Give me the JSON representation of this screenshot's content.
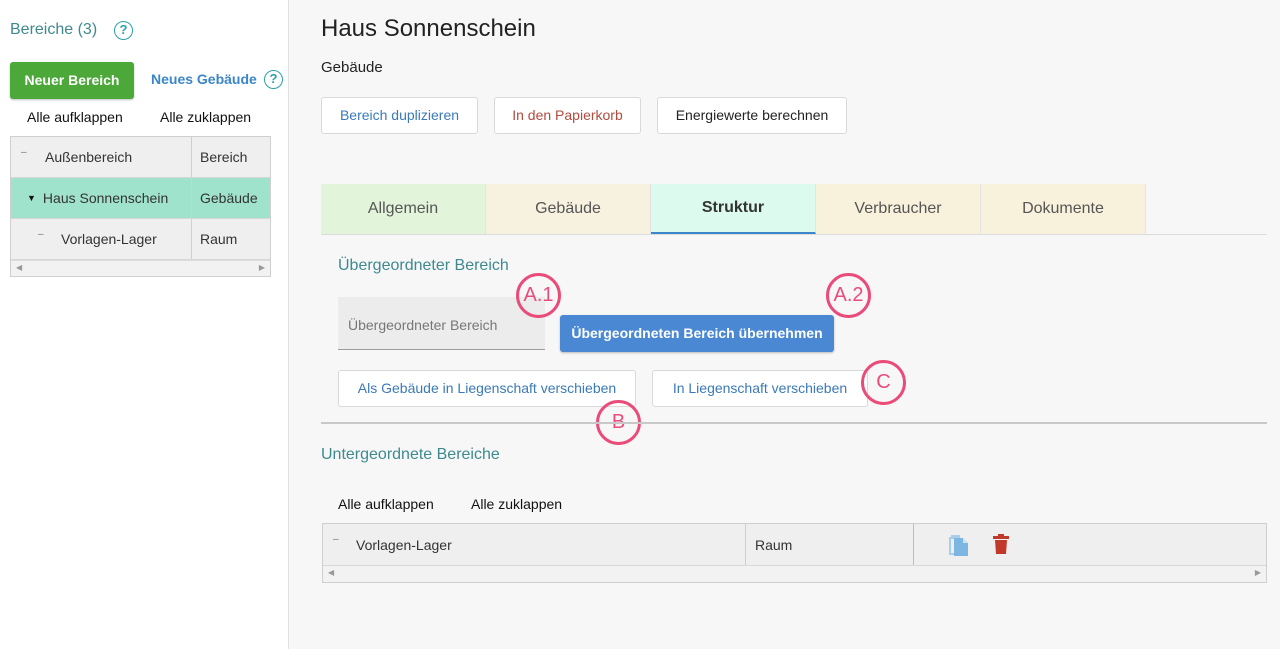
{
  "sidebar": {
    "title": "Bereiche (3)",
    "help": "?",
    "new_area_button": "Neuer Bereich",
    "new_building_link": "Neues Gebäude",
    "expand_all": "Alle aufklappen",
    "collapse_all": "Alle zuklappen",
    "tree": [
      {
        "name": "Außenbereich",
        "type": "Bereich"
      },
      {
        "name": "Haus Sonnenschein",
        "type": "Gebäude",
        "selected": true
      },
      {
        "name": "Vorlagen-Lager",
        "type": "Raum"
      }
    ]
  },
  "main": {
    "title": "Haus Sonnenschein",
    "subtitle": "Gebäude",
    "actions": {
      "duplicate": "Bereich duplizieren",
      "trash": "In den Papierkorb",
      "energy": "Energiewerte berechnen"
    },
    "tabs": [
      {
        "label": "Allgemein",
        "color": "#e2f5da"
      },
      {
        "label": "Gebäude",
        "color": "#f7f1df"
      },
      {
        "label": "Struktur",
        "color": "#dcfaee",
        "active": true
      },
      {
        "label": "Verbraucher",
        "color": "#f8f1dc"
      },
      {
        "label": "Dokumente",
        "color": "#f8f1dc"
      }
    ],
    "parent_section": {
      "title": "Übergeordneter Bereich",
      "input_placeholder": "Übergeordneter Bereich",
      "apply_button": "Übergeordneten Bereich übernehmen",
      "move_as_building_button": "Als Gebäude in Liegenschaft verschieben",
      "move_to_property_button": "In Liegenschaft verschieben"
    },
    "markers": {
      "a1": "A.1",
      "a2": "A.2",
      "b": "B",
      "c": "C"
    },
    "child_section": {
      "title": "Untergeordnete Bereiche",
      "expand_all": "Alle aufklappen",
      "collapse_all": "Alle zuklappen",
      "rows": [
        {
          "name": "Vorlagen-Lager",
          "type": "Raum"
        }
      ]
    }
  },
  "colors": {
    "accent_green": "#4ba839",
    "accent_blue": "#4a88d4",
    "marker_pink": "#ea4c7a",
    "teal_text": "#3e8a8f"
  }
}
